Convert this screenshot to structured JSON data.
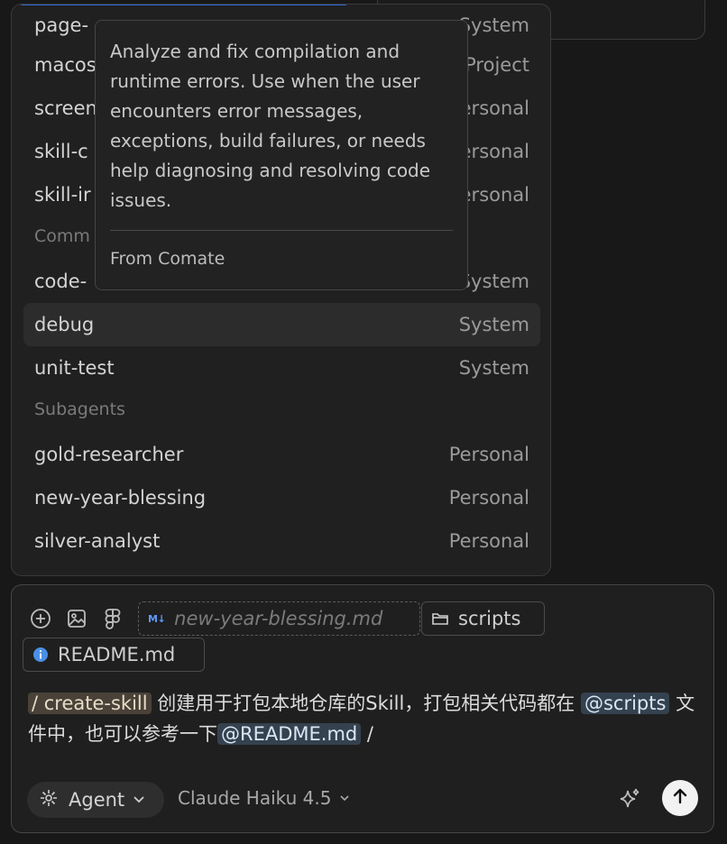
{
  "popup": {
    "items": [
      {
        "label": "page-",
        "source": "System"
      },
      {
        "label": "macos",
        "source": "Project"
      },
      {
        "label": "screen",
        "source": "Personal"
      },
      {
        "label": "skill-c",
        "source": "Personal"
      },
      {
        "label": "skill-ir",
        "source": "Personal"
      }
    ],
    "section_commands": "Comm",
    "commands": [
      {
        "label": "code-",
        "source": "System"
      },
      {
        "label": "debug",
        "source": "System"
      },
      {
        "label": "unit-test",
        "source": "System"
      }
    ],
    "section_subagents": "Subagents",
    "subagents": [
      {
        "label": "gold-researcher",
        "source": "Personal"
      },
      {
        "label": "new-year-blessing",
        "source": "Personal"
      },
      {
        "label": "silver-analyst",
        "source": "Personal"
      }
    ]
  },
  "tooltip": {
    "description": "Analyze and fix compilation and runtime errors. Use when the user encounters error messages, exceptions, build failures, or needs help diagnosing and resolving code issues.",
    "from": "From Comate"
  },
  "composer": {
    "attachments": {
      "markdown_file": "new-year-blessing.md",
      "markdown_badge": "M↓",
      "folder": "scripts",
      "readme": "README.md"
    },
    "message": {
      "command": "/ create-skill",
      "text1": " 创建用于打包本地仓库的Skill，打包相关代码都在 ",
      "ref1": "@scripts",
      "text2": " 文件中，也可以参考一下",
      "ref2": "@README.md",
      "text3": " /"
    },
    "mode": "Agent",
    "model": "Claude Haiku 4.5"
  },
  "colors": {
    "accent_blue": "#2f6bd8",
    "info_blue": "#4a8fe6",
    "send_bg": "#f2f2f2"
  }
}
